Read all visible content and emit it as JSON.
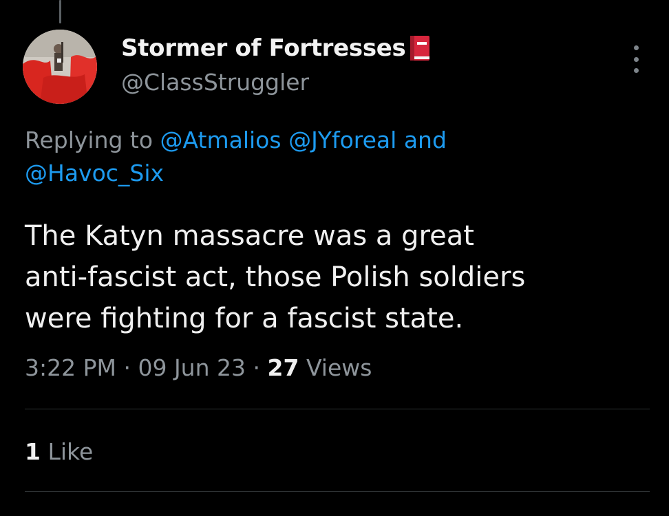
{
  "tweet": {
    "display_name": "Stormer of Fortresses",
    "badge_icon": "red-book-icon",
    "handle": "@ClassStruggler",
    "more_icon": "more-vertical-icon",
    "reply": {
      "prefix": "Replying to",
      "mention_1": "@Atmalios",
      "mention_2": "@JYforeal",
      "joiner": "and",
      "mention_3": "@Havoc_Six"
    },
    "text_lines": [
      "The Katyn massacre was a great",
      "anti-fascist act, those Polish soldiers",
      "were fighting for a fascist state."
    ],
    "time": "3:22 PM",
    "sep_1": "·",
    "date": "09 Jun 23",
    "sep_2": "·",
    "views_count": "27",
    "views_label": "Views",
    "likes_count": "1",
    "likes_label": "Like"
  },
  "colors": {
    "background": "#000000",
    "mention": "#1d9bf0",
    "secondary_text": "#8e959b",
    "primary_text": "#f0f0f0",
    "badge_red": "#d7263d"
  }
}
